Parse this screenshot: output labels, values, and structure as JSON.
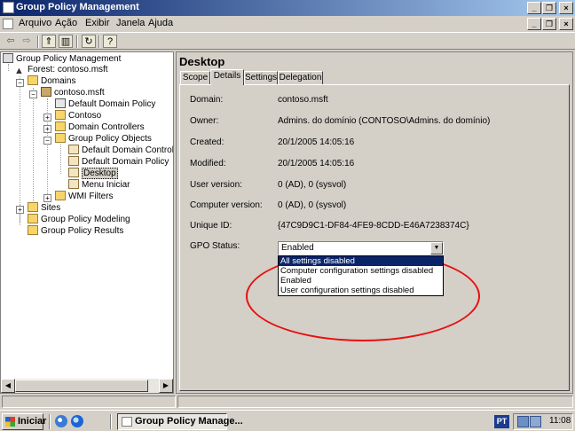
{
  "window": {
    "title": "Group Policy Management"
  },
  "menu": [
    "Arquivo",
    "Ação",
    "Exibir",
    "Janela",
    "Ajuda"
  ],
  "tree": [
    {
      "label": "Group Policy Management",
      "icon": "gpm-icon"
    },
    {
      "label": "Forest: contoso.msft",
      "icon": "forest-icon"
    },
    {
      "label": "Domains",
      "icon": "folder-icon"
    },
    {
      "label": "contoso.msft",
      "icon": "domain-icon"
    },
    {
      "label": "Default Domain Policy",
      "icon": "gpo-link-icon"
    },
    {
      "label": "Contoso",
      "icon": "ou-folder-icon"
    },
    {
      "label": "Domain Controllers",
      "icon": "ou-folder-icon"
    },
    {
      "label": "Group Policy Objects",
      "icon": "folder-icon"
    },
    {
      "label": "Default Domain Controller",
      "icon": "scroll-icon"
    },
    {
      "label": "Default Domain Policy",
      "icon": "scroll-icon"
    },
    {
      "label": "Desktop",
      "icon": "scroll-icon"
    },
    {
      "label": "Menu Iniciar",
      "icon": "scroll-icon"
    },
    {
      "label": "WMI Filters",
      "icon": "folder-icon"
    },
    {
      "label": "Sites",
      "icon": "folder-icon"
    },
    {
      "label": "Group Policy Modeling",
      "icon": "folder-icon"
    },
    {
      "label": "Group Policy Results",
      "icon": "folder-icon"
    }
  ],
  "panel": {
    "title": "Desktop",
    "tabs": [
      "Scope",
      "Details",
      "Settings",
      "Delegation"
    ],
    "active_tab": "Details"
  },
  "details": [
    {
      "label": "Domain:",
      "value": "contoso.msft"
    },
    {
      "label": "Owner:",
      "value": "Admins. do domínio (CONTOSO\\Admins. do domínio)"
    },
    {
      "label": "Created:",
      "value": "20/1/2005 14:05:16"
    },
    {
      "label": "Modified:",
      "value": "20/1/2005 14:05:16"
    },
    {
      "label": "User version:",
      "value": "0 (AD), 0 (sysvol)"
    },
    {
      "label": "Computer version:",
      "value": "0 (AD), 0 (sysvol)"
    },
    {
      "label": "Unique ID:",
      "value": "{47C9D9C1-DF84-4FE9-8CDD-E46A7238374C}"
    }
  ],
  "gpo_status": {
    "label": "GPO Status:",
    "selected": "Enabled",
    "options": [
      "All settings disabled",
      "Computer configuration settings disabled",
      "Enabled",
      "User configuration settings disabled"
    ],
    "highlighted_option": "All settings disabled"
  },
  "taskbar": {
    "start_label": "Iniciar",
    "task_label": "Group Policy Manage...",
    "language": "PT",
    "clock": "11:08"
  },
  "colors": {
    "annotation_ring": "#e81010",
    "titlebar": "#0a246a",
    "selection": "#0a246a"
  }
}
